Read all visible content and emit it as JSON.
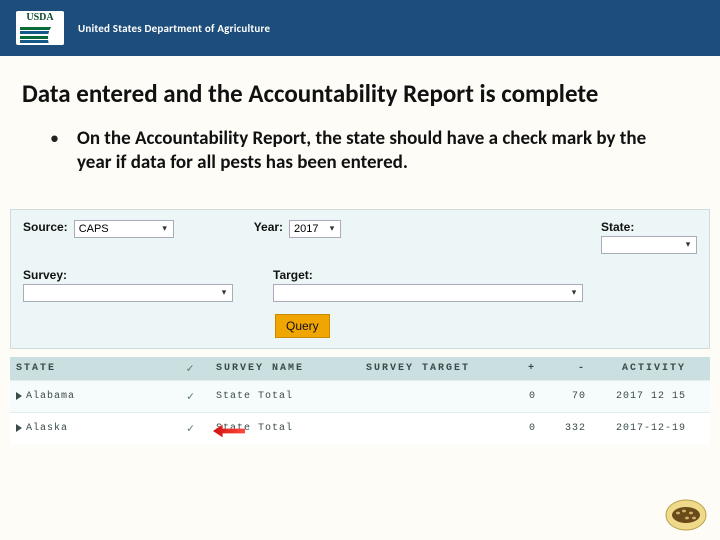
{
  "header": {
    "logo_text": "USDA",
    "dept": "United States Department of Agriculture"
  },
  "slide": {
    "title": "Data entered and the Accountability Report is complete",
    "bullet": "On the Accountability Report, the state should have a check mark by the year if data for all pests has been entered."
  },
  "filters": {
    "source_label": "Source:",
    "source_value": "CAPS",
    "year_label": "Year:",
    "year_value": "2017",
    "state_label": "State:",
    "state_value": "",
    "survey_label": "Survey:",
    "survey_value": "",
    "target_label": "Target:",
    "target_value": "",
    "query_label": "Query"
  },
  "table": {
    "headers": {
      "state": "STATE",
      "check": "✓",
      "survey_name": "SURVEY NAME",
      "survey_target": "SURVEY TARGET",
      "plus": "+",
      "minus": "-",
      "activity": "ACTIVITY"
    },
    "rows": [
      {
        "state": "Alabama",
        "check": "✓",
        "name": "State Total",
        "target": "",
        "plus": "0",
        "minus": "70",
        "activity": "2017 12 15"
      },
      {
        "state": "Alaska",
        "check": "✓",
        "name": "State Total",
        "target": "",
        "plus": "0",
        "minus": "332",
        "activity": "2017-12-19"
      }
    ]
  }
}
